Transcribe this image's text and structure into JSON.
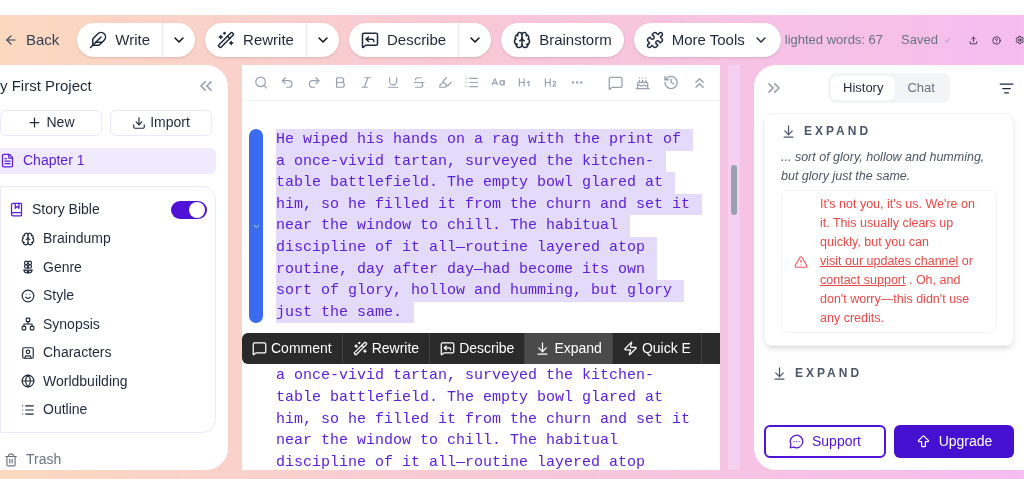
{
  "toolbar": {
    "back": "Back",
    "tools": [
      {
        "label": "Write",
        "dropdown": true,
        "caret": false
      },
      {
        "label": "Rewrite",
        "dropdown": true,
        "caret": false
      },
      {
        "label": "Describe",
        "dropdown": true,
        "caret": false
      },
      {
        "label": "Brainstorm",
        "dropdown": false,
        "caret": false
      },
      {
        "label": "More Tools",
        "dropdown": false,
        "caret": true
      }
    ],
    "word_count": "lighted words: 67",
    "save_status": "Saved"
  },
  "sidebar": {
    "project": "y First Project",
    "new": "New",
    "import": "Import",
    "chapters": [
      {
        "label": "Chapter 1",
        "selected": true
      }
    ],
    "story_bible": {
      "label": "Story Bible",
      "on": true,
      "items": [
        "Braindump",
        "Genre",
        "Style",
        "Synopsis",
        "Characters",
        "Worldbuilding",
        "Outline"
      ]
    },
    "trash": "Trash"
  },
  "editor": {
    "selected_lines": [
      "He wiped his hands on a rag with the print of",
      "a once-vivid tartan, surveyed the kitchen-",
      "table battlefield. The empty bowl glared at",
      "him, so he filled it from the churn and set it",
      "near the window to chill. The habitual",
      "discipline of it all—routine layered atop",
      "routine, day after day—had become its own",
      "sort of glory, hollow and humming, but glory",
      "just the same."
    ],
    "bubble_menu": [
      {
        "label": "Comment",
        "selected": false
      },
      {
        "label": "Rewrite",
        "selected": false
      },
      {
        "label": "Describe",
        "selected": false
      },
      {
        "label": "Expand",
        "selected": true
      },
      {
        "label": "Quick E",
        "selected": false
      }
    ],
    "next_lines": [
      "a once-vivid tartan, surveyed the kitchen-",
      "table battlefield. The empty bowl glared at",
      "him, so he filled it from the churn and set it",
      "near the window to chill. The habitual",
      "discipline of it all—routine layered atop"
    ]
  },
  "panel": {
    "tabs": [
      {
        "label": "History",
        "selected": true
      },
      {
        "label": "Chat",
        "selected": false
      }
    ],
    "cards": [
      {
        "title": "EXPAND",
        "excerpt": "... sort of glory, hollow and humming, but glory just the same.",
        "error": [
          {
            "kind": "text",
            "text": "It's not you, it's us. We're on it. This usually clears up quickly, but you can"
          },
          {
            "kind": "link",
            "text": "visit our updates channel"
          },
          {
            "kind": "text",
            "text": "or"
          },
          {
            "kind": "link",
            "text": "contact support"
          },
          {
            "kind": "text",
            "text": ". Oh, and don't worry—this didn't use any credits."
          }
        ]
      },
      {
        "title": "EXPAND"
      }
    ],
    "support": "Support",
    "upgrade": "Upgrade"
  }
}
